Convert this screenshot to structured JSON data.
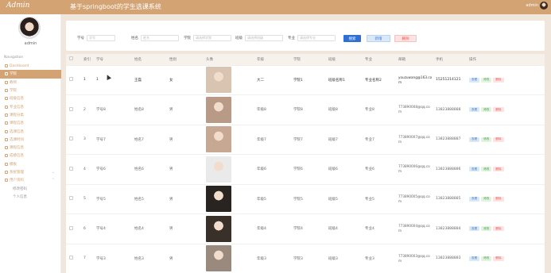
{
  "app": {
    "logo": "Admin",
    "title": "基于springboot的学生选课系统",
    "top_user": "admin"
  },
  "sidebar": {
    "username": "admin",
    "section": "Navigation",
    "items": [
      {
        "label": "Dashboard",
        "icon": "home-icon"
      },
      {
        "label": "学院",
        "icon": "grid-icon",
        "active": true
      },
      {
        "label": "教师",
        "icon": "list-icon"
      },
      {
        "label": "学院",
        "icon": "grid-icon"
      },
      {
        "label": "班级信息",
        "icon": "grid-icon"
      },
      {
        "label": "专业信息",
        "icon": "grid-icon"
      },
      {
        "label": "课程分类",
        "icon": "user-icon"
      },
      {
        "label": "课程信息",
        "icon": "grid-icon"
      },
      {
        "label": "选课信息",
        "icon": "grid-icon"
      },
      {
        "label": "选课时间",
        "icon": "grid-icon"
      },
      {
        "label": "课程信息",
        "icon": "grid-icon"
      },
      {
        "label": "成绩信息",
        "icon": "flag-icon"
      },
      {
        "label": "模板",
        "icon": "pin-icon"
      },
      {
        "label": "系统管理",
        "icon": "grid-icon",
        "chevron": "⌄"
      },
      {
        "label": "用户资料",
        "icon": "doc-icon",
        "chevron": "⌃"
      },
      {
        "label": "修改密码",
        "sub": true
      },
      {
        "label": "个人信息",
        "sub": true
      }
    ]
  },
  "search": {
    "fields": [
      {
        "label": "学号",
        "placeholder": "学号"
      },
      {
        "label": "姓名",
        "placeholder": "姓名"
      },
      {
        "label": "学院",
        "placeholder": "请选择学院"
      },
      {
        "label": "班级",
        "placeholder": "请选择班级"
      },
      {
        "label": "专业",
        "placeholder": "请选择专业"
      }
    ],
    "search_btn": "搜索",
    "add_btn": "新增",
    "delete_btn": "删除"
  },
  "table": {
    "headers": [
      "",
      "索引",
      "学号",
      "姓名",
      "性别",
      "头像",
      "年级",
      "学院",
      "班级",
      "专业",
      "邮箱",
      "手机",
      "操作"
    ],
    "actions": {
      "view": "查看",
      "edit": "修改",
      "delete": "删除"
    },
    "rows": [
      {
        "index": "1",
        "xuehao": "1",
        "name": "王磊",
        "sex": "女",
        "grade": "大二",
        "college": "学院1",
        "class": "班级名称1",
        "major": "专业名称2",
        "email": "youzuwang@163.com",
        "phone": "15251214121",
        "photo": "#d8c4b0"
      },
      {
        "index": "2",
        "xuehao": "学号8",
        "name": "姓名8",
        "sex": "男",
        "grade": "年级8",
        "college": "学院8",
        "class": "班级8",
        "major": "专业8",
        "email": "773890008@qq.com",
        "phone": "13823888888",
        "photo": "#b89a86"
      },
      {
        "index": "3",
        "xuehao": "学号7",
        "name": "姓名7",
        "sex": "男",
        "grade": "年级7",
        "college": "学院7",
        "class": "班级7",
        "major": "专业7",
        "email": "773890007@qq.com",
        "phone": "13823888887",
        "photo": "#c7a893"
      },
      {
        "index": "4",
        "xuehao": "学号6",
        "name": "姓名6",
        "sex": "男",
        "grade": "年级6",
        "college": "学院6",
        "class": "班级6",
        "major": "专业6",
        "email": "773890006@qq.com",
        "phone": "13823888886",
        "photo": "#eaeaea"
      },
      {
        "index": "5",
        "xuehao": "学号5",
        "name": "姓名5",
        "sex": "男",
        "grade": "年级5",
        "college": "学院5",
        "class": "班级5",
        "major": "专业5",
        "email": "773890005@qq.com",
        "phone": "13823888885",
        "photo": "#2a2420"
      },
      {
        "index": "6",
        "xuehao": "学号4",
        "name": "姓名4",
        "sex": "男",
        "grade": "年级4",
        "college": "学院4",
        "class": "班级4",
        "major": "专业4",
        "email": "773890004@qq.com",
        "phone": "13823888884",
        "photo": "#3a302a"
      },
      {
        "index": "7",
        "xuehao": "学号3",
        "name": "姓名3",
        "sex": "男",
        "grade": "年级3",
        "college": "学院3",
        "class": "班级3",
        "major": "专业3",
        "email": "773890003@qq.com",
        "phone": "13823888883",
        "photo": "#9a8a7e"
      }
    ]
  },
  "colors": {
    "accent": "#d4a373",
    "background": "#f0e6dc",
    "primary_btn": "#2e6fd6"
  }
}
